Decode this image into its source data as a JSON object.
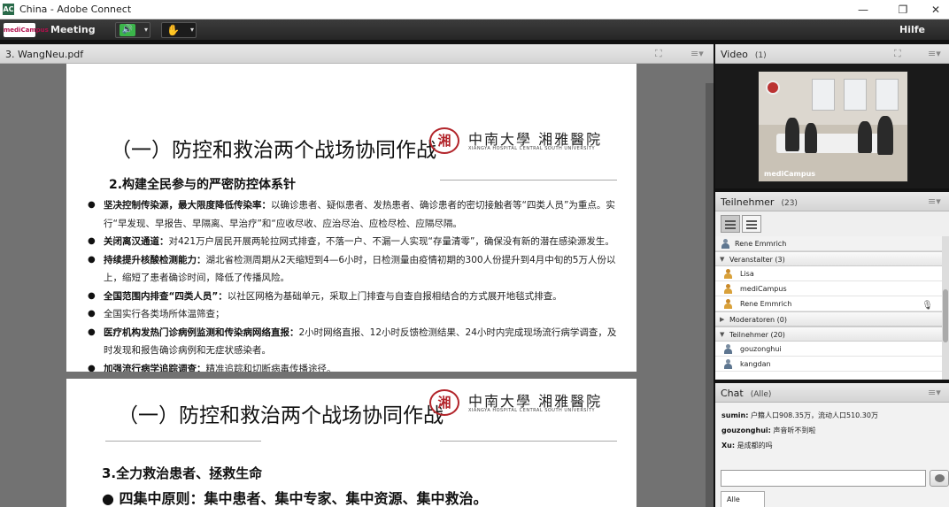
{
  "window": {
    "title": "China - Adobe Connect",
    "btn_min": "—",
    "btn_max": "❐",
    "btn_close": "✕"
  },
  "menubar": {
    "logo": "mediCampus",
    "meeting": "Meeting",
    "help": "Hilfe",
    "speaker_icon": "🔊",
    "raise_icon": "✋",
    "dropdown": "▾"
  },
  "share": {
    "title": "3. WangNeu.pdf",
    "page1": {
      "title": "（一）防控和救治两个战场协同作战",
      "section": "2.构建全民参与的严密防控体系针",
      "bullets": [
        {
          "bold": "坚决控制传染源，最大限度降低传染率：",
          "text": "以确诊患者、疑似患者、发热患者、确诊患者的密切接触者等“四类人员”为重点。实行“早发现、早报告、早隔离、早治疗”和“应收尽收、应治尽治、应检尽检、应隔尽隔。"
        },
        {
          "bold": "关闭离汉通道：",
          "text": "对421万户居民开展两轮拉网式排查，不落一户、不漏一人实现“存量清零”，确保没有新的潜在感染源发生。"
        },
        {
          "bold": "持续提升核酸检测能力：",
          "text": "湖北省检测周期从2天缩短到4—6小时，日检测量由疫情初期的300人份提升到4月中旬的5万人份以上，缩短了患者确诊时间，降低了传播风险。"
        },
        {
          "bold": "全国范围内排查“四类人员”：",
          "text": "以社区网格为基础单元，采取上门排查与自查自报相结合的方式展开地毯式排查。"
        },
        {
          "bold": "",
          "text": "全国实行各类场所体温筛查；"
        },
        {
          "bold": "医疗机构发热门诊病例监测和传染病网络直报：",
          "text": "2小时网络直报、12小时反馈检测结果、24小时内完成现场流行病学调查，及时发现和报告确诊病例和无症状感染者。"
        },
        {
          "bold": "加强流行病学追踪调查：",
          "text": "精准追踪和切断病毒传播途径。"
        }
      ]
    },
    "page2": {
      "title": "（一）防控和救治两个战场协同作战",
      "section": "3.全力救治患者、拯救生命",
      "big_bullet": "四集中原则：集中患者、集中专家、集中资源、集中救治。"
    },
    "hospital_logo": {
      "seal": "湘",
      "name": "中南大學 湘雅醫院",
      "sub": "XIANGYA HOSPITAL CENTRAL SOUTH UNIVERSITY"
    }
  },
  "video": {
    "title": "Video",
    "count": "(1)",
    "feed_name": "mediCampus"
  },
  "participants": {
    "title": "Teilnehmer",
    "count": "(23)",
    "self": "Rene Emmrich",
    "groups": [
      {
        "label": "Veranstalter (3)",
        "expanded": true,
        "users": [
          "Lisa",
          "mediCampus",
          "Rene Emmrich"
        ]
      },
      {
        "label": "Moderatoren (0)",
        "expanded": false,
        "users": []
      },
      {
        "label": "Teilnehmer (20)",
        "expanded": true,
        "users": [
          "gouzonghui",
          "kangdan"
        ]
      }
    ]
  },
  "chat": {
    "title": "Chat",
    "scope": "(Alle)",
    "messages": [
      {
        "from": "sumin:",
        "text": "户籍人口908.35万，流动人口510.30万"
      },
      {
        "from": "gouzonghui:",
        "text": "声音听不到啦"
      },
      {
        "from": "Xu:",
        "text": "是成都的吗"
      }
    ],
    "input_placeholder": "",
    "tab": "Alle"
  },
  "pod_menu_icon": "≡▾",
  "fullscreen_icon": "⛶"
}
